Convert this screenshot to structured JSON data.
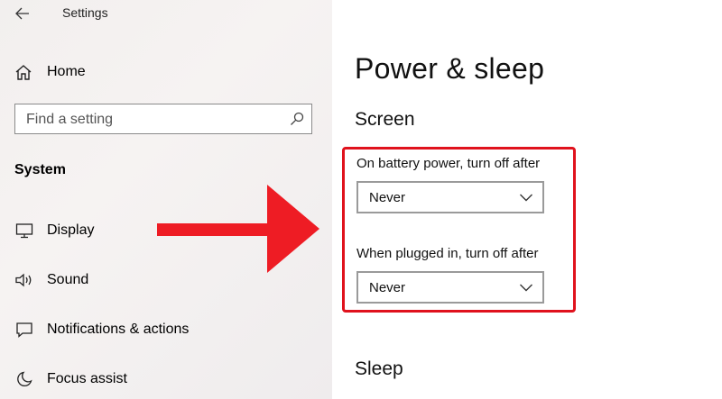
{
  "window": {
    "title": "Settings"
  },
  "sidebar": {
    "home_label": "Home",
    "search_placeholder": "Find a setting",
    "section_label": "System",
    "items": [
      {
        "label": "Display",
        "icon": "monitor-icon"
      },
      {
        "label": "Sound",
        "icon": "speaker-icon"
      },
      {
        "label": "Notifications & actions",
        "icon": "notification-icon"
      },
      {
        "label": "Focus assist",
        "icon": "moon-icon"
      }
    ]
  },
  "main": {
    "title": "Power & sleep",
    "screen_header": "Screen",
    "battery_label": "On battery power, turn off after",
    "battery_value": "Never",
    "plugged_label": "When plugged in, turn off after",
    "plugged_value": "Never",
    "sleep_header": "Sleep"
  },
  "colors": {
    "highlight": "#e0121d",
    "arrow": "#ee1c24"
  }
}
